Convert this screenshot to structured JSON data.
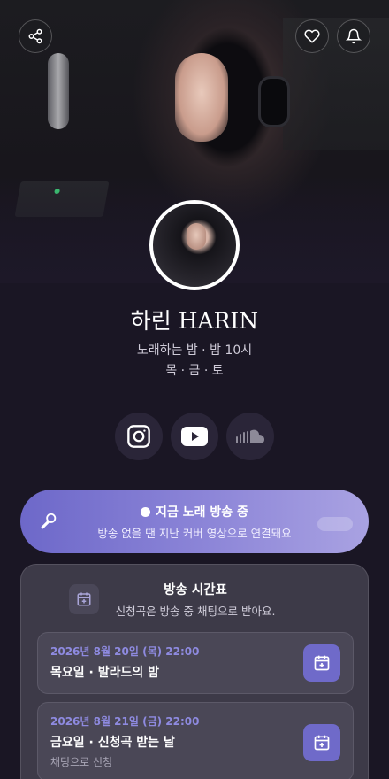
{
  "profile": {
    "name": "하린 HARIN",
    "tagline": "노래하는 밤 · 밤 10시",
    "days": "목 · 금 · 토"
  },
  "top_bar": {
    "share_icon": "share-icon",
    "like_icon": "heart-icon",
    "notify_icon": "bell-icon"
  },
  "socials": [
    "instagram-icon",
    "youtube-icon",
    "soundcloud-icon"
  ],
  "live": {
    "status": "지금 노래 방송 중",
    "description": "방송 없을 땐 지난 커버 영상으로 연결돼요"
  },
  "schedule": {
    "title": "방송 시간표",
    "subtitle": "신청곡은 방송 중 채팅으로 받아요.",
    "events": [
      {
        "date": "2026년 8월 20일 (목) 22:00",
        "title": "목요일 · 발라드의 밤",
        "note": ""
      },
      {
        "date": "2026년 8월 21일 (금) 22:00",
        "title": "금요일 · 신청곡 받는 날",
        "note": "채팅으로 신청"
      }
    ]
  },
  "colors": {
    "background": "#1a1624",
    "accent": "#6f6ac9",
    "date_text": "#8e8ae0"
  }
}
